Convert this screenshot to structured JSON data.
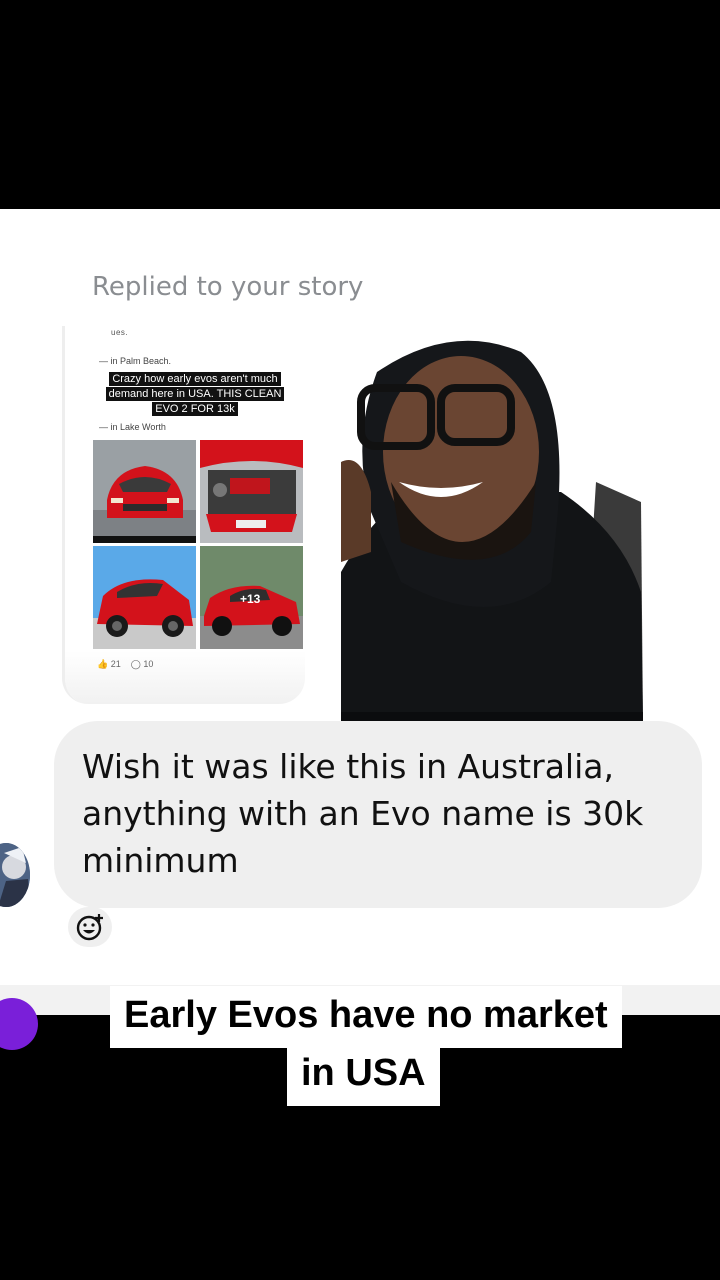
{
  "story_reply": {
    "header": "Replied to your story",
    "story": {
      "location_1": "— in Palm Beach.",
      "caption": "Crazy how early evos aren't much demand here in USA. THIS CLEAN EVO 2 FOR 13k",
      "location_2": "— in Lake Worth",
      "more_photos": "+13",
      "likes": "21",
      "comments": "10"
    }
  },
  "message": {
    "text": "Wish it was like this in Australia, anything with an Evo name is 30k minimum"
  },
  "overlay_caption": {
    "line1": "Early Evos have no market",
    "line2": "in USA"
  },
  "colors": {
    "bubble": "#efefef",
    "header_gray": "#8a8d91",
    "car_red": "#d3121b"
  }
}
